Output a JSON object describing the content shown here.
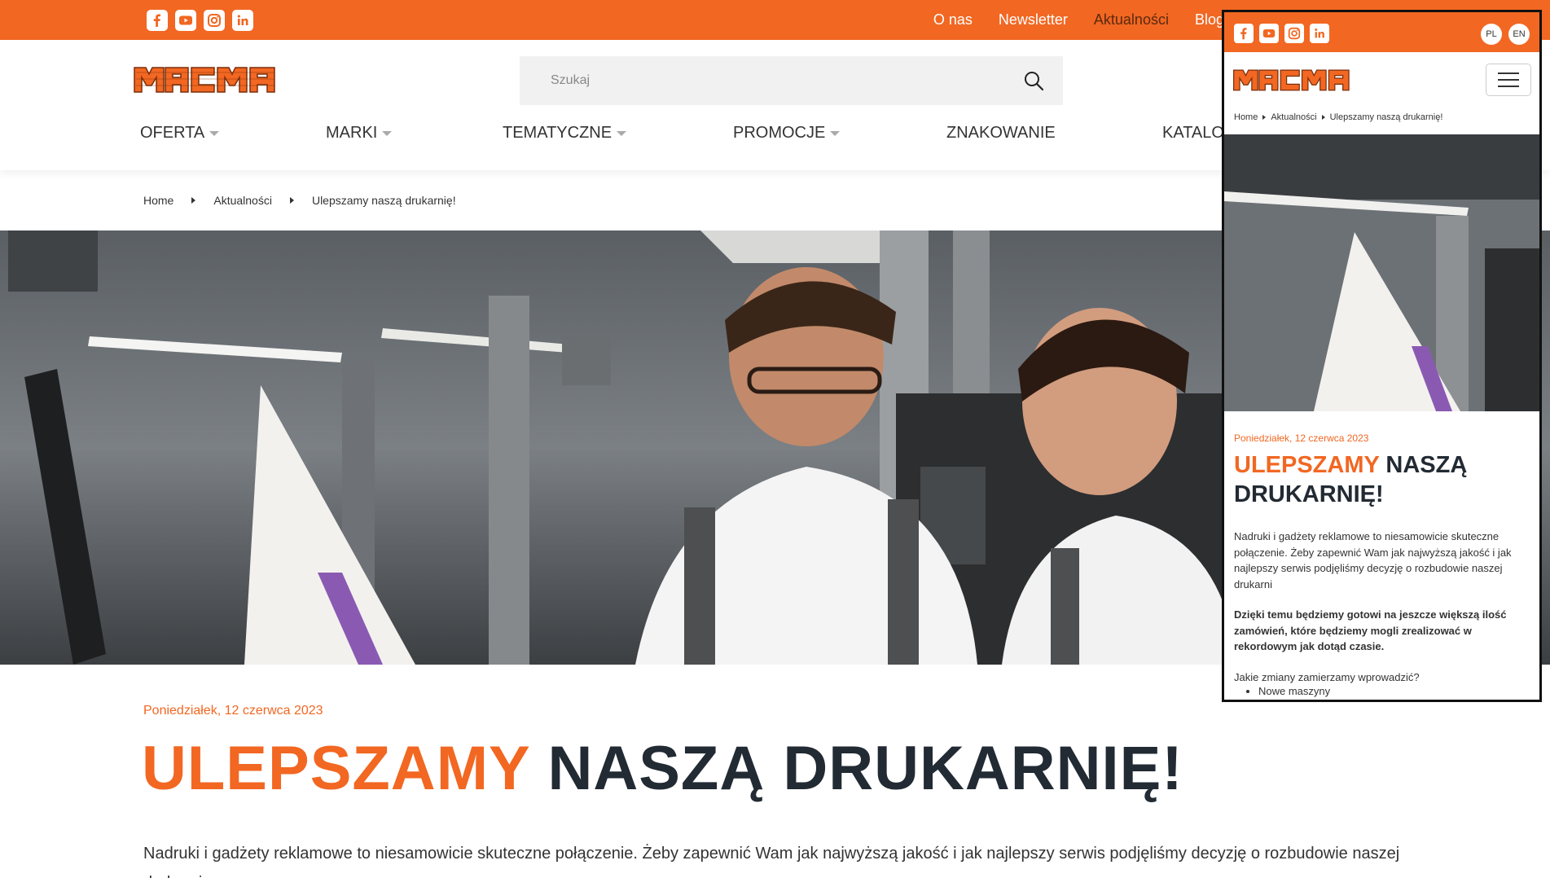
{
  "colors": {
    "brand": "#f26722",
    "dark_text": "#222a33",
    "topnav_active": "#5a2a10"
  },
  "social": [
    "facebook-icon",
    "youtube-icon",
    "instagram-icon",
    "linkedin-icon"
  ],
  "topnav": {
    "about": "O nas",
    "newsletter": "Newsletter",
    "news": "Aktualności",
    "blog": "Blog"
  },
  "search": {
    "placeholder": "Szukaj"
  },
  "mainnav": {
    "offer": "OFERTA",
    "brands": "MARKI",
    "thematic": "TEMATYCZNE",
    "promotions": "PROMOCJE",
    "marking": "ZNAKOWANIE",
    "catalogs": "KATALO"
  },
  "breadcrumb": {
    "home": "Home",
    "news": "Aktualności",
    "current": "Ulepszamy naszą drukarnię!"
  },
  "article": {
    "date": "Poniedziałek, 12 czerwca 2023",
    "title_accent": "ULEPSZAMY",
    "title_rest": "NASZĄ DRUKARNIĘ!",
    "lead": "Nadruki i gadżety reklamowe to niesamowicie skuteczne połączenie. Żeby zapewnić Wam jak najwyższą jakość i jak najlepszy serwis podjęliśmy decyzję o rozbudowie naszej drukarni"
  },
  "mobile": {
    "lang_pl": "PL",
    "lang_en": "EN",
    "bold_paragraph": "Dzięki temu będziemy gotowi na jeszcze większą ilość zamówień, które będziemy mogli zrealizować w rekordowym jak dotąd czasie.",
    "question": "Jakie zmiany zamierzamy wprowadzić?",
    "list_item_1": "Nowe maszyny"
  }
}
